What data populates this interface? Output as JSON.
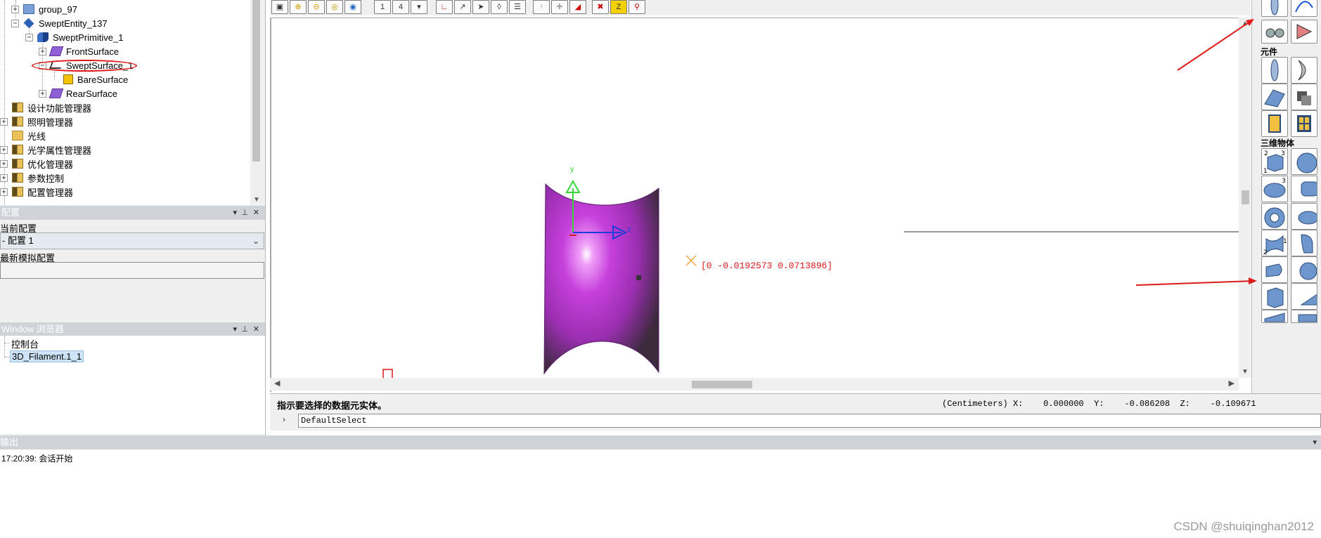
{
  "tree": {
    "items": [
      {
        "label": "group_97"
      },
      {
        "label": "SweptEntity_137"
      },
      {
        "label": "SweptPrimitive_1"
      },
      {
        "label": "FrontSurface"
      },
      {
        "label": "SweptSurface_1"
      },
      {
        "label": "BareSurface"
      },
      {
        "label": "RearSurface"
      },
      {
        "label": "设计功能管理器"
      },
      {
        "label": "照明管理器"
      },
      {
        "label": "光线"
      },
      {
        "label": "光学属性管理器"
      },
      {
        "label": "优化管理器"
      },
      {
        "label": "参数控制"
      },
      {
        "label": "配置管理器"
      }
    ]
  },
  "config_panel": {
    "title": "配置",
    "current_label": "当前配置",
    "current_value": "- 配置 1",
    "new_sim_label": "最新模拟配置"
  },
  "window_panel": {
    "title": "Window 浏览器",
    "items": [
      "控制台",
      "3D_Filament.1_1"
    ]
  },
  "viewport": {
    "axis_y": "y",
    "axis_z": "z",
    "pick_readout": "[0 -0.0192573 0.0713896]",
    "surface_color": "#c040d8"
  },
  "status": {
    "message": "指示要选择的数据元实体。",
    "coords": "(Centimeters) X:    0.000000  Y:    -0.086208  Z:    -0.109671",
    "command": "DefaultSelect"
  },
  "output": {
    "title": "输出",
    "line": "17:20:39: 会话开始"
  },
  "palette": {
    "section_components": "元件",
    "section_3d": "三维物体"
  },
  "watermark": "CSDN @shuiqinghan2012",
  "colors": {
    "annotation_red": "#e01a1a",
    "highlight_red": "#e01a1a"
  }
}
